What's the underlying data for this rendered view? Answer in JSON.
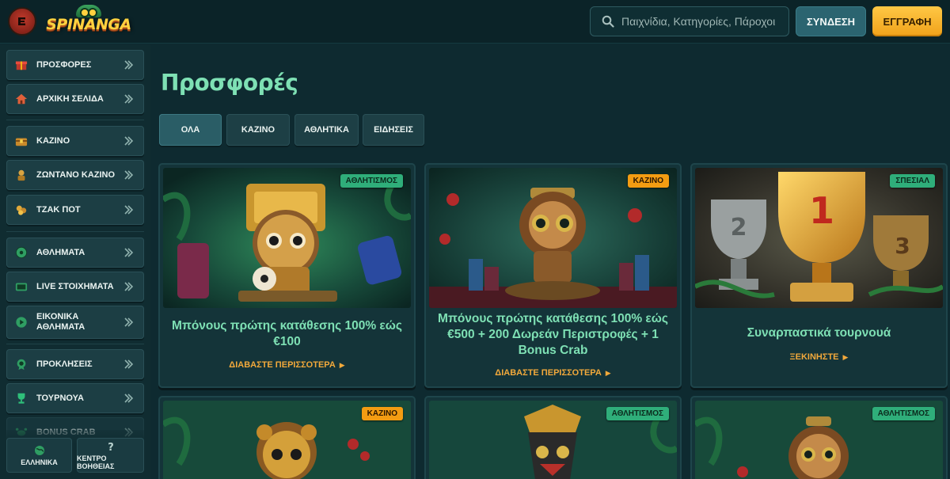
{
  "header": {
    "logo_text": "SPINANGA",
    "search_placeholder": "Παιχνίδια, Κατηγορίες, Πάροχοι",
    "login_label": "ΣΥΝΔΕΣΗ",
    "register_label": "ΕΓΓΡΑΦΗ"
  },
  "sidebar": {
    "items": [
      {
        "label": "ΠΡΟΣΦΟΡΕΣ",
        "icon": "gift-icon"
      },
      {
        "label": "ΑΡΧΙΚΗ ΣΕΛΙΔΑ",
        "icon": "home-icon"
      },
      {
        "label": "ΚΑΖΙΝΟ",
        "icon": "chest-icon"
      },
      {
        "label": "ΖΩΝΤΑΝΟ ΚΑΖΙΝΟ",
        "icon": "dealer-icon"
      },
      {
        "label": "ΤΖΑΚ ΠΟΤ",
        "icon": "jackpot-icon"
      },
      {
        "label": "ΑΘΛΗΜΑΤΑ",
        "icon": "football-icon"
      },
      {
        "label": "LIVE ΣΤΟΙΧΗΜΑΤΑ",
        "icon": "live-icon"
      },
      {
        "label": "ΕΙΚΟΝΙΚΑ ΑΘΛΗΜΑΤΑ",
        "icon": "virtual-sports-icon"
      },
      {
        "label": "ΠΡΟΚΛΗΣΕΙΣ",
        "icon": "challenge-icon"
      },
      {
        "label": "ΤΟΥΡΝΟΥΑ",
        "icon": "trophy-icon"
      },
      {
        "label": "BONUS CRAB",
        "icon": "crab-icon"
      }
    ],
    "bottom": {
      "language_label": "ΕΛΛΗΝΙΚΑ",
      "help_label": "ΚΕΝΤΡΟ ΒΟΗΘΕΙΑΣ"
    }
  },
  "main": {
    "title": "Προσφορές",
    "tabs": [
      "ΟΛΑ",
      "ΚΑΖΙΝΟ",
      "ΑΘΛΗΤΙΚΑ",
      "ΕΙΔΗΣΕΙΣ"
    ],
    "active_tab": "ΟΛΑ",
    "cards": [
      {
        "badge": "ΑΘΛΗΤΙΣΜΟΣ",
        "title": "Μπόνους πρώτης κατάθεσης 100% εώς €100",
        "link": "ΔΙΑΒΑΣΤΕ ΠΕΡΙΣΣΟΤΕΡΑ"
      },
      {
        "badge": "ΚΑΖΙΝΟ",
        "title": "Μπόνους πρώτης κατάθεσης 100% εώς €500 + 200 Δωρεάν Περιστροφές + 1 Bonus Crab",
        "link": "ΔΙΑΒΑΣΤΕ ΠΕΡΙΣΣΟΤΕΡΑ"
      },
      {
        "badge": "ΣΠΕΣΙΑΛ",
        "title": "Συναρπαστικά τουρνουά",
        "link": "ΞΕΚΙΝΗΣΤΕ"
      },
      {
        "badge": "ΚΑΖΙΝΟ"
      },
      {
        "badge": "ΑΘΛΗΤΙΣΜΟΣ"
      },
      {
        "badge": "ΑΘΛΗΤΙΣΜΟΣ"
      }
    ]
  },
  "colors": {
    "background": "#0e2a30",
    "accent_green": "#7ee0b4",
    "accent_orange": "#f2a93b",
    "register_yellow": "#ffc845"
  }
}
